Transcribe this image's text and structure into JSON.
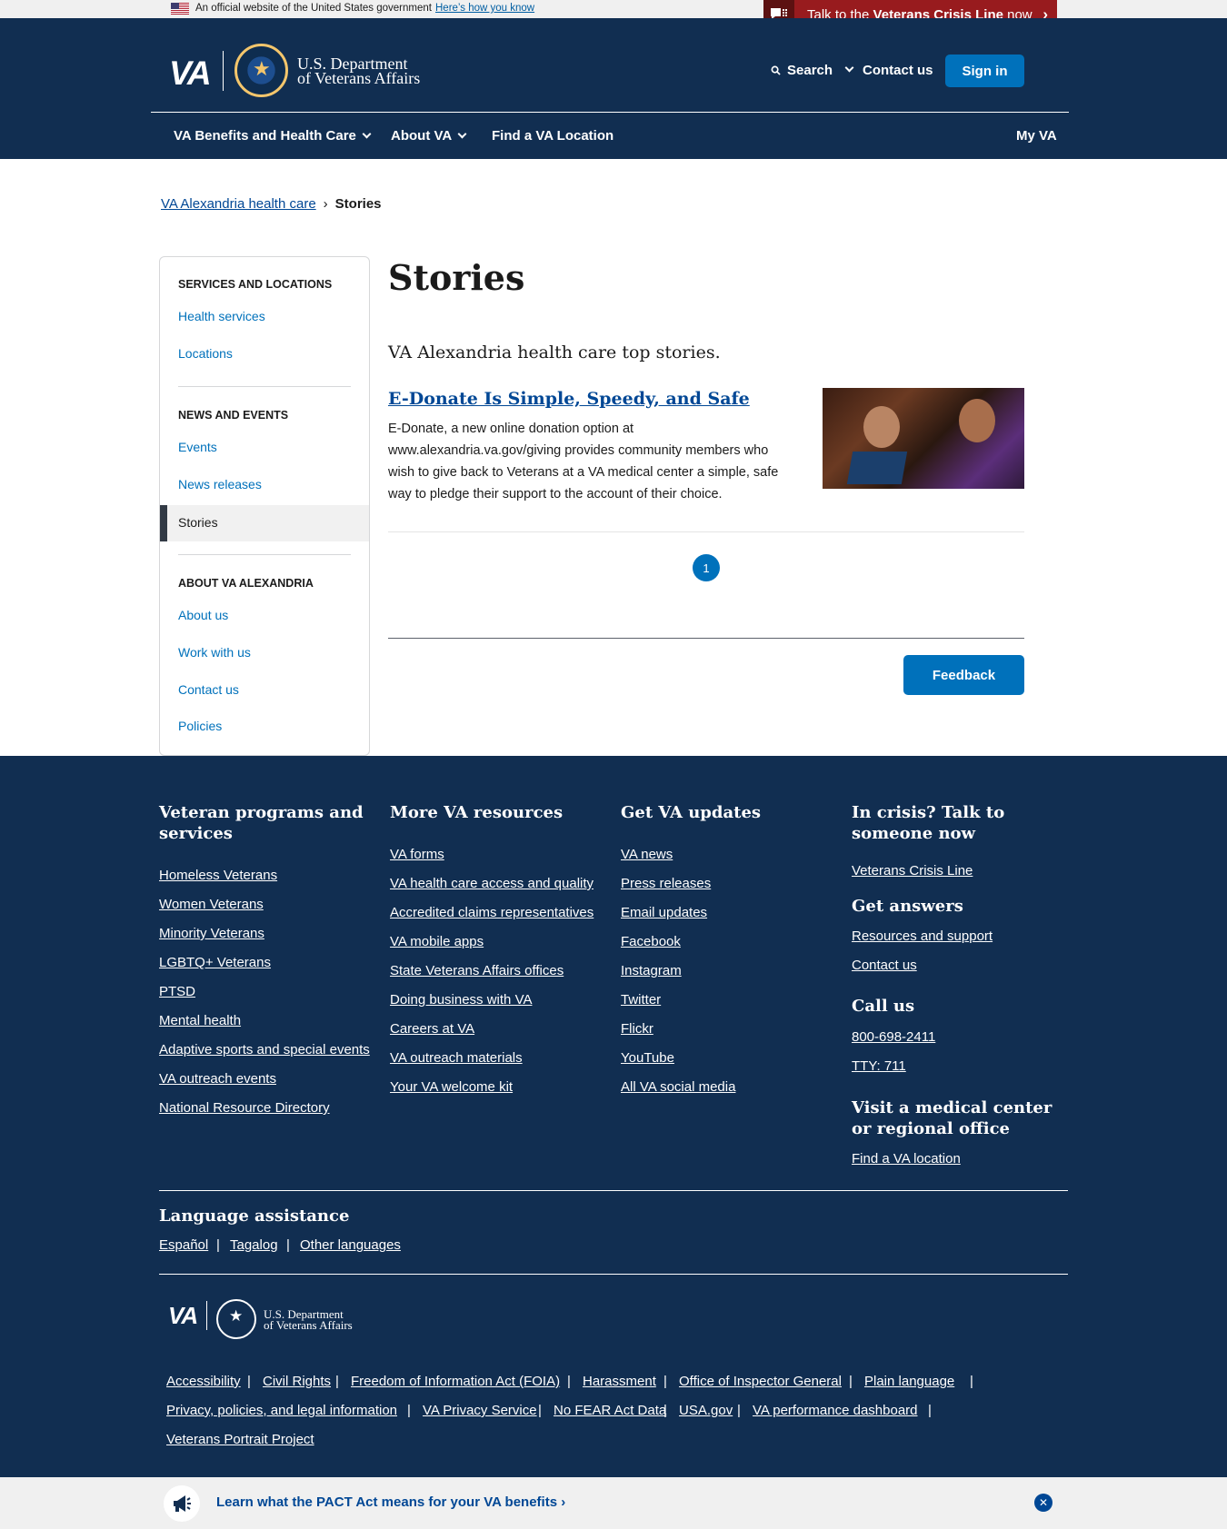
{
  "official_banner": {
    "text": "An official website of the United States government",
    "link": "Here’s how you know"
  },
  "crisis": {
    "prefix": "Talk to the ",
    "name": "Veterans Crisis Line",
    "suffix": " now"
  },
  "header": {
    "logo": "VA",
    "dept_line1": "U.S. Department",
    "dept_line2": "of Veterans Affairs",
    "search": "Search",
    "contact": "Contact us",
    "signin": "Sign in",
    "nav": {
      "benefits": "VA Benefits and Health Care",
      "about": "About VA",
      "find": "Find a VA Location",
      "myva": "My VA"
    }
  },
  "breadcrumb": {
    "parent": "VA Alexandria health care",
    "separator": "›",
    "current": "Stories"
  },
  "sidebar": {
    "sec1": "Services and locations",
    "health_services": "Health services",
    "locations": "Locations",
    "sec2": "News and events",
    "events": "Events",
    "news_releases": "News releases",
    "stories": "Stories",
    "sec3": "About VA Alexandria",
    "about_us": "About us",
    "work_with_us": "Work with us",
    "contact_us": "Contact us",
    "policies": "Policies"
  },
  "main": {
    "title": "Stories",
    "intro": "VA Alexandria health care top stories.",
    "story_title": "E-Donate Is Simple, Speedy, and Safe",
    "story_body": "E-Donate, a new online donation option at www.alexandria.va.gov/giving provides community members who wish to give back to Veterans at a VA medical center a simple, safe way to pledge their support to the account of their choice.",
    "page": "1",
    "feedback": "Feedback"
  },
  "footer": {
    "col1_title": "Veteran programs and services",
    "col1": [
      "Homeless Veterans",
      "Women Veterans",
      "Minority Veterans",
      "LGBTQ+ Veterans",
      "PTSD",
      "Mental health",
      "Adaptive sports and special events",
      "VA outreach events",
      "National Resource Directory"
    ],
    "col2_title": "More VA resources",
    "col2": [
      "VA forms",
      "VA health care access and quality",
      "Accredited claims representatives",
      "VA mobile apps",
      "State Veterans Affairs offices",
      "Doing business with VA",
      "Careers at VA",
      "VA outreach materials",
      "Your VA welcome kit"
    ],
    "col3_title": "Get VA updates",
    "col3": [
      "VA news",
      "Press releases",
      "Email updates",
      "Facebook",
      "Instagram",
      "Twitter",
      "Flickr",
      "YouTube",
      "All VA social media"
    ],
    "crisis_title": "In crisis? Talk to someone now",
    "crisis_link": "Veterans Crisis Line",
    "answers_title": "Get answers",
    "answers": [
      "Resources and support",
      "Contact us"
    ],
    "call_title": "Call us",
    "phone": "800-698-2411",
    "tty": "TTY: 711",
    "visit_title": "Visit a medical center or regional office",
    "visit_link": "Find a VA location",
    "lang_title": "Language assistance",
    "lang": [
      "Español",
      "Tagalog",
      "Other languages"
    ],
    "logo": "VA",
    "dept_line1": "U.S. Department",
    "dept_line2": "of Veterans Affairs",
    "legal": [
      "Accessibility",
      "Civil Rights",
      "Freedom of Information Act (FOIA)",
      "Harassment",
      "Office of Inspector General",
      "Plain language",
      "Privacy, policies, and legal information",
      "VA Privacy Service",
      "No FEAR Act Data",
      "USA.gov",
      "VA performance dashboard",
      "Veterans Portrait Project"
    ],
    "sep": "|"
  },
  "pact": {
    "text": "Learn what the PACT Act means for your VA benefits ›",
    "close": "✕"
  }
}
